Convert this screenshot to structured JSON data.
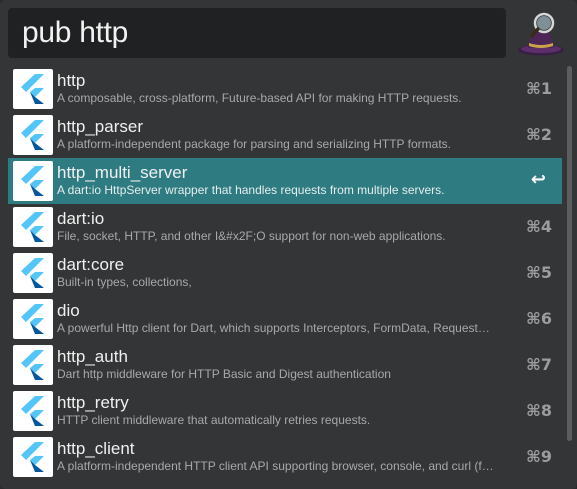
{
  "search": {
    "query": "pub http"
  },
  "results": [
    {
      "title": "http",
      "subtitle": "A composable, cross-platform, Future-based API for making HTTP requests.",
      "shortcut": "⌘1",
      "selected": false
    },
    {
      "title": "http_parser",
      "subtitle": "A platform-independent package for parsing and serializing HTTP formats.",
      "shortcut": "⌘2",
      "selected": false
    },
    {
      "title": "http_multi_server",
      "subtitle": "A dart:io HttpServer wrapper that handles requests from multiple servers.",
      "shortcut": "↩",
      "selected": true
    },
    {
      "title": "dart:io",
      "subtitle": "File, socket, HTTP, and other I&#x2F;O support for non-web applications.",
      "shortcut": "⌘4",
      "selected": false
    },
    {
      "title": "dart:core",
      "subtitle": "Built-in types, collections,",
      "shortcut": "⌘5",
      "selected": false
    },
    {
      "title": "dio",
      "subtitle": "A powerful Http client for Dart, which supports Interceptors, FormData, Request…",
      "shortcut": "⌘6",
      "selected": false
    },
    {
      "title": "http_auth",
      "subtitle": "Dart http middleware for HTTP Basic and Digest authentication",
      "shortcut": "⌘7",
      "selected": false
    },
    {
      "title": "http_retry",
      "subtitle": "HTTP client middleware that automatically retries requests.",
      "shortcut": "⌘8",
      "selected": false
    },
    {
      "title": "http_client",
      "subtitle": "A platform-independent HTTP client API supporting browser, console, and curl (f…",
      "shortcut": "⌘9",
      "selected": false
    }
  ],
  "icons": {
    "result_icon": "flutter-icon",
    "app_icon": "alfred-hat-icon"
  },
  "colors": {
    "selected_row": "#2f7b82",
    "flutter_light": "#54c5f8",
    "flutter_dark": "#01579b"
  }
}
